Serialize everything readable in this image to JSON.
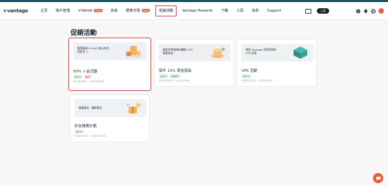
{
  "brand": {
    "name": "vantage",
    "accent": "#1b4d5b",
    "highlight": "#c7413b",
    "chat_color": "#e8603a"
  },
  "nav": {
    "items": [
      {
        "label": "主頁",
        "badge": ""
      },
      {
        "label": "賬戶管理",
        "badge": ""
      },
      {
        "label": "V-Wallet",
        "badge": "NEW"
      },
      {
        "label": "資金",
        "badge": ""
      },
      {
        "label": "跟單交易",
        "badge": "NEW"
      },
      {
        "label": "促銷活動",
        "badge": ""
      },
      {
        "label": "Vantage Rewards",
        "badge": ""
      },
      {
        "label": "下載",
        "badge": ""
      },
      {
        "label": "工具",
        "badge": ""
      },
      {
        "label": "信息",
        "badge": ""
      },
      {
        "label": "Support",
        "badge": ""
      }
    ],
    "active_index": 5,
    "pill_label": "入金"
  },
  "page": {
    "title": "促銷活動"
  },
  "cards": [
    {
      "banner_text": "獲得高達 $1,000 美元的信用紅利 >",
      "title": "50% 入金活動",
      "tags": [
        "進行中",
        "獲得"
      ],
      "date": "05/05/2021 - 12/31/2030"
    },
    {
      "banner_text": "鎖定利率會每年賺取 13% 無限收益",
      "title": "每年 13% 賞金措長",
      "tags": [
        "進行中",
        "僅限客戶"
      ],
      "date": "05/05/2024 - 01/01/2030"
    },
    {
      "banner_text": "使用 Vantage 享受免費的 VPS 託管",
      "title": "VPS 活動",
      "tags": [
        "進行中"
      ],
      "date": "05/05/2021 - 12/31/2030"
    },
    {
      "banner_text": "推薦朋友・賺取獎金",
      "title": "好友推薦計劃",
      "tags": [
        "進行中"
      ],
      "date": "05/09/2021 - 12/31/2030"
    }
  ]
}
